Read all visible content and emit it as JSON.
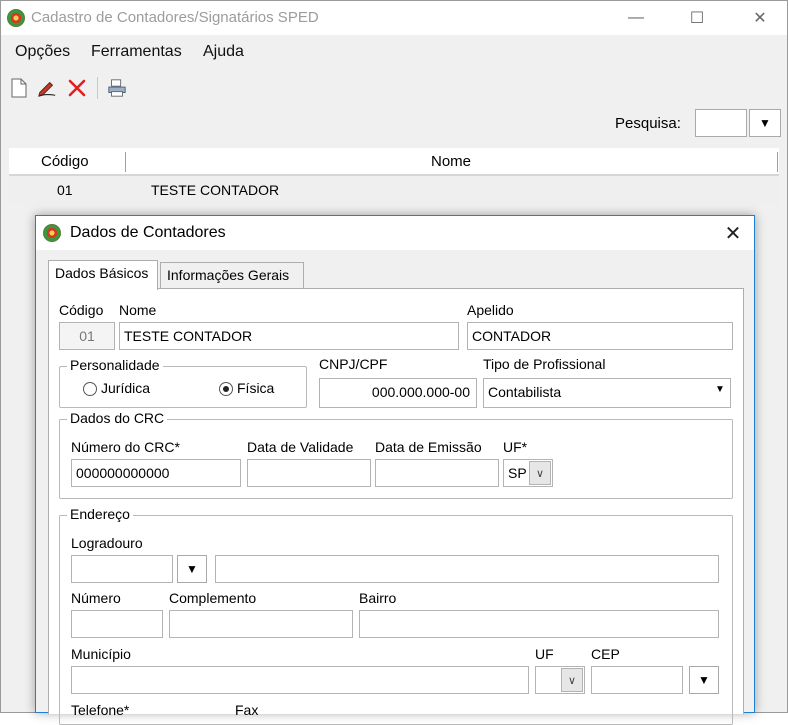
{
  "main_window": {
    "title": "Cadastro de Contadores/Signatários SPED",
    "controls": {
      "minimize": "—",
      "maximize": "☐",
      "close": "✕"
    },
    "menu": [
      "Opções",
      "Ferramentas",
      "Ajuda"
    ],
    "toolbar": {
      "icons": [
        "new-document-icon",
        "edit-pencil-icon",
        "delete-x-icon",
        "print-icon"
      ]
    },
    "search": {
      "label": "Pesquisa:",
      "value": ""
    },
    "grid": {
      "columns": [
        "Código",
        "Nome"
      ],
      "rows": [
        {
          "codigo": "01",
          "nome": "TESTE CONTADOR"
        }
      ]
    }
  },
  "dialog": {
    "title": "Dados de Contadores",
    "close": "✕",
    "tabs": [
      "Dados Básicos",
      "Informações Gerais"
    ],
    "active_tab": "Dados Básicos",
    "fields": {
      "codigo": {
        "label": "Código",
        "value": "01"
      },
      "nome": {
        "label": "Nome",
        "value": "TESTE CONTADOR"
      },
      "apelido": {
        "label": "Apelido",
        "value": "CONTADOR"
      },
      "personalidade": {
        "label": "Personalidade",
        "options": [
          "Jurídica",
          "Física"
        ],
        "selected": "Física"
      },
      "cnpj_cpf": {
        "label": "CNPJ/CPF",
        "value": "000.000.000-00"
      },
      "tipo_profissional": {
        "label": "Tipo de Profissional",
        "value": "Contabilista"
      },
      "crc_group": {
        "title": "Dados do CRC",
        "numero": {
          "label": "Número do CRC*",
          "value": "000000000000"
        },
        "validade": {
          "label": "Data de Validade",
          "value": ""
        },
        "emissao": {
          "label": "Data de Emissão",
          "value": ""
        },
        "uf": {
          "label": "UF*",
          "value": "SP"
        }
      },
      "endereco_group": {
        "title": "Endereço",
        "logradouro": {
          "label": "Logradouro",
          "type_value": "",
          "value": ""
        },
        "numero": {
          "label": "Número",
          "value": ""
        },
        "complemento": {
          "label": "Complemento",
          "value": ""
        },
        "bairro": {
          "label": "Bairro",
          "value": ""
        },
        "municipio": {
          "label": "Município",
          "value": ""
        },
        "uf": {
          "label": "UF",
          "value": ""
        },
        "cep": {
          "label": "CEP",
          "value": ""
        },
        "telefone": {
          "label": "Telefone*"
        },
        "fax": {
          "label": "Fax"
        }
      }
    }
  },
  "colors": {
    "dialog_border": "#1e7fd4",
    "window_bg": "#f0f0f0"
  }
}
